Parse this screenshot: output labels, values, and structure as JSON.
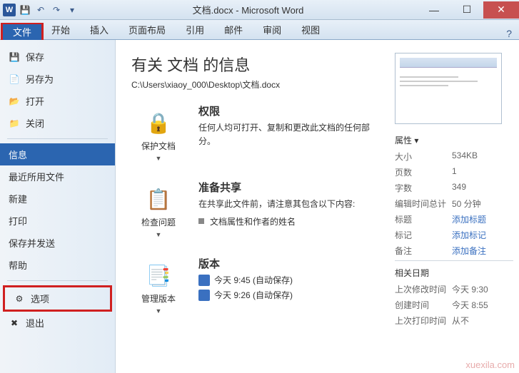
{
  "title": "文档.docx - Microsoft Word",
  "qat": [
    "save",
    "undo",
    "redo"
  ],
  "ribbon": {
    "tabs": [
      "文件",
      "开始",
      "插入",
      "页面布局",
      "引用",
      "邮件",
      "审阅",
      "视图"
    ],
    "active": 0
  },
  "sidebar": {
    "groups": [
      [
        {
          "icon": "💾",
          "label": "保存"
        },
        {
          "icon": "📄",
          "label": "另存为"
        },
        {
          "icon": "📂",
          "label": "打开"
        },
        {
          "icon": "📁",
          "label": "关闭"
        }
      ],
      [
        {
          "label": "信息",
          "selected": true
        },
        {
          "label": "最近所用文件"
        },
        {
          "label": "新建"
        },
        {
          "label": "打印"
        },
        {
          "label": "保存并发送"
        },
        {
          "label": "帮助"
        }
      ],
      [
        {
          "icon": "⚙",
          "label": "选项",
          "highlight": true
        },
        {
          "icon": "✖",
          "label": "退出"
        }
      ]
    ]
  },
  "main": {
    "heading": "有关 文档 的信息",
    "path": "C:\\Users\\xiaoy_000\\Desktop\\文档.docx",
    "sections": [
      {
        "btn_icon": "🔒",
        "btn_label": "保护文档",
        "heading": "权限",
        "body": "任何人均可打开、复制和更改此文档的任何部分。"
      },
      {
        "btn_icon": "📋",
        "btn_label": "检查问题",
        "heading": "准备共享",
        "body": "在共享此文件前，请注意其包含以下内容:",
        "bullets": [
          "文档属性和作者的姓名"
        ]
      },
      {
        "btn_icon": "📑",
        "btn_label": "管理版本",
        "heading": "版本",
        "versions": [
          "今天 9:45 (自动保存)",
          "今天 9:26 (自动保存)"
        ]
      }
    ]
  },
  "props": {
    "head1": "属性 ▾",
    "rows1": [
      {
        "label": "大小",
        "val": "534KB"
      },
      {
        "label": "页数",
        "val": "1"
      },
      {
        "label": "字数",
        "val": "349"
      },
      {
        "label": "编辑时间总计",
        "val": "50 分钟"
      },
      {
        "label": "标题",
        "val": "添加标题",
        "link": true
      },
      {
        "label": "标记",
        "val": "添加标记",
        "link": true
      },
      {
        "label": "备注",
        "val": "添加备注",
        "link": true
      }
    ],
    "head2": "相关日期",
    "rows2": [
      {
        "label": "上次修改时间",
        "val": "今天 9:30"
      },
      {
        "label": "创建时间",
        "val": "今天 8:55"
      },
      {
        "label": "上次打印时间",
        "val": "从不"
      }
    ]
  },
  "watermark": "xuexila.com"
}
